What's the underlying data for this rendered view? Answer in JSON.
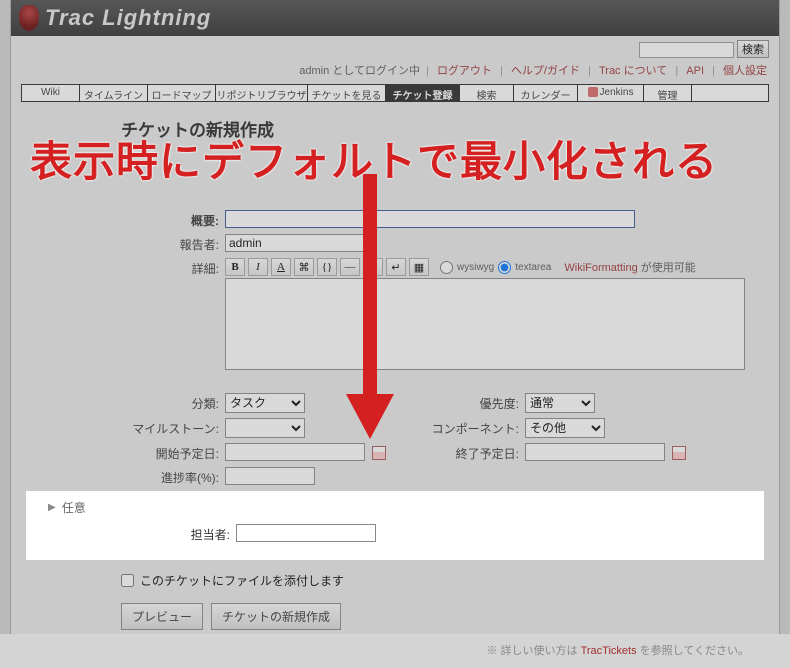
{
  "brand": {
    "name": "Trac Lightning"
  },
  "top_search": {
    "button": "検索"
  },
  "metanav": {
    "logged_in_prefix": "admin としてログイン中",
    "logout": "ログアウト",
    "help": "ヘルプ/ガイド",
    "about": "Trac について",
    "api": "API",
    "prefs": "個人設定"
  },
  "mainnav": {
    "tabs": [
      "Wiki",
      "タイムライン",
      "ロードマップ",
      "リポジトリブラウザ",
      "チケットを見る",
      "チケット登録",
      "検索",
      "カレンダー",
      "Jenkins",
      "管理",
      ""
    ],
    "active_index": 5
  },
  "page": {
    "title": "チケットの新規作成"
  },
  "fields": {
    "summary_label": "概要:",
    "reporter_label": "報告者:",
    "reporter_value": "admin",
    "description_label": "詳細:",
    "radio_wysiwyg": "wysiwyg",
    "radio_textarea": "textarea",
    "wikiformat_link": "WikiFormatting",
    "wikiformat_suffix": " が使用可能",
    "type_label": "分類:",
    "type_value": "タスク",
    "priority_label": "優先度:",
    "priority_value": "通常",
    "milestone_label": "マイルストーン:",
    "component_label": "コンポーネント:",
    "component_value": "その他",
    "start_label": "開始予定日:",
    "end_label": "終了予定日:",
    "progress_label": "進捗率(%):"
  },
  "optional": {
    "header": "任意",
    "owner_label": "担当者:"
  },
  "attach": {
    "label": "このチケットにファイルを添付します"
  },
  "buttons": {
    "preview": "プレビュー",
    "create": "チケットの新規作成"
  },
  "help": {
    "prefix": "※ 詳しい使い方は ",
    "link": "TracTickets",
    "suffix": " を参照してください。"
  },
  "annotation": "表示時にデフォルトで最小化される"
}
